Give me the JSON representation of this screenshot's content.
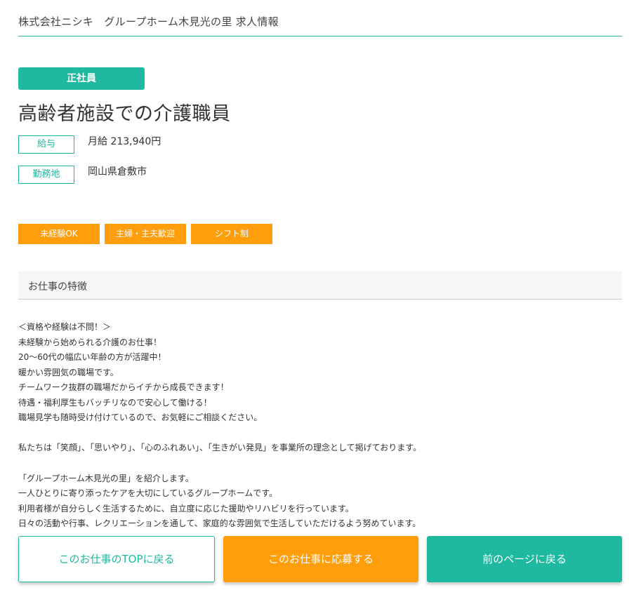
{
  "header": {
    "title": "株式会社ニシキ　グループホーム木見光の里 求人情報"
  },
  "job": {
    "employment_type": "正社員",
    "title": "高齢者施設での介護職員",
    "salary_label": "給与",
    "salary_value": "月給 213,940円",
    "location_label": "勤務地",
    "location_value": "岡山県倉敷市"
  },
  "tags": [
    "未経験OK",
    "主婦・主夫歓迎",
    "シフト制"
  ],
  "features": {
    "heading": "お仕事の特徴",
    "lines": [
      "＜資格や経験は不問！＞",
      "未経験から始められる介護のお仕事！",
      "20～60代の幅広い年齢の方が活躍中！",
      "暖かい雰囲気の職場です。",
      "チームワーク抜群の職場だからイチから成長できます！",
      "待遇・福利厚生もバッチリなので安心して働ける！",
      "職場見学も随時受け付けているので、お気軽にご相談ください。",
      "",
      "私たちは「笑顔」、「思いやり」、「心のふれあい」、「生きがい発見」を事業所の理念として掲げております。",
      "",
      "「グループホーム木見光の里」を紹介します。",
      "一人ひとりに寄り添ったケアを大切にしているグループホームです。",
      "利用者様が自分らしく生活するために、自立度に応じた援助やリハビリを行っています。",
      "日々の活動や行事、レクリエーションを通して、家庭的な雰囲気で生活していただけるよう努めています。"
    ]
  },
  "buttons": {
    "top": "このお仕事のTOPに戻る",
    "apply": "このお仕事に応募する",
    "back": "前のページに戻る"
  },
  "colors": {
    "accent": "#1fb99f",
    "tag": "#ff9e0d"
  }
}
